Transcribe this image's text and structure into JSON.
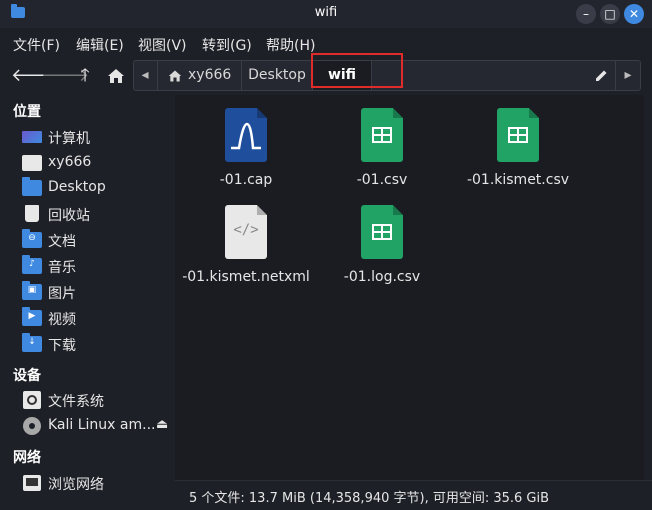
{
  "window": {
    "title": "wifi"
  },
  "menu": [
    "文件(F)",
    "编辑(E)",
    "视图(V)",
    "转到(G)",
    "帮助(H)"
  ],
  "path": {
    "home": "xy666",
    "crumbs": [
      "Desktop",
      "wifi"
    ]
  },
  "sidebar": {
    "places_header": "位置",
    "places": [
      {
        "label": "计算机",
        "icon": "computer-icon"
      },
      {
        "label": "xy666",
        "icon": "home-folder-icon"
      },
      {
        "label": "Desktop",
        "icon": "desktop-folder-icon"
      },
      {
        "label": "回收站",
        "icon": "trash-icon"
      },
      {
        "label": "文档",
        "icon": "documents-folder-icon"
      },
      {
        "label": "音乐",
        "icon": "music-folder-icon"
      },
      {
        "label": "图片",
        "icon": "pictures-folder-icon"
      },
      {
        "label": "视频",
        "icon": "videos-folder-icon"
      },
      {
        "label": "下载",
        "icon": "downloads-folder-icon"
      }
    ],
    "devices_header": "设备",
    "devices": [
      {
        "label": "文件系统",
        "icon": "drive-icon"
      },
      {
        "label": "Kali Linux am...",
        "icon": "optical-disc-icon"
      }
    ],
    "network_header": "网络",
    "network": [
      {
        "label": "浏览网络",
        "icon": "network-icon"
      }
    ]
  },
  "files": [
    {
      "name": "-01.cap",
      "type": "cap"
    },
    {
      "name": "-01.csv",
      "type": "csv"
    },
    {
      "name": "-01.kismet.csv",
      "type": "csv"
    },
    {
      "name": "-01.kismet.netxml",
      "type": "xml"
    },
    {
      "name": "-01.log.csv",
      "type": "csv"
    }
  ],
  "status": "5 个文件: 13.7 MiB (14,358,940 字节), 可用空间: 35.6 GiB",
  "colors": {
    "accent": "#3f8ae0",
    "csv": "#21a366",
    "cap": "#1f4e9c",
    "xml": "#e8e8e8",
    "highlight": "#e02b2b"
  }
}
